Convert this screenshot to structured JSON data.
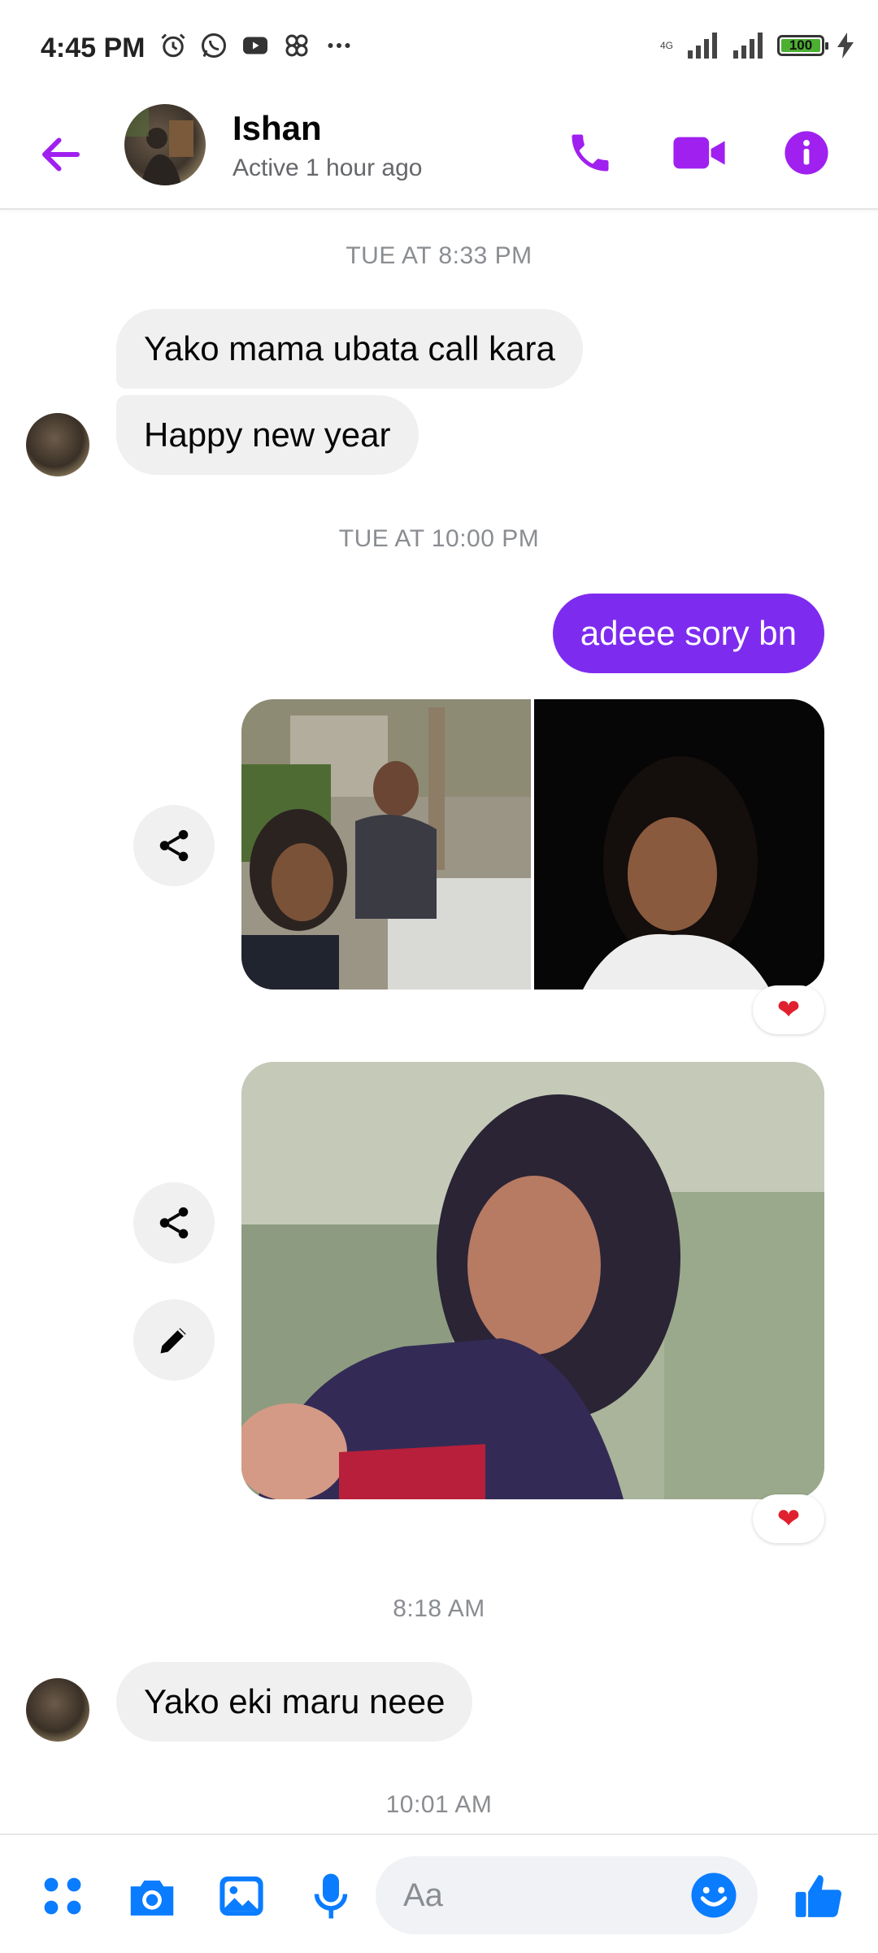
{
  "status_bar": {
    "time": "4:45 PM",
    "network": "4G",
    "battery": "100"
  },
  "header": {
    "contact_name": "Ishan",
    "contact_status": "Active 1 hour ago"
  },
  "messages": {
    "timestamp_1": "TUE AT 8:33 PM",
    "in_1": "Yako mama ubata call kara",
    "in_2": "Happy new year",
    "timestamp_2": "TUE AT 10:00 PM",
    "out_1": "adeee sory bn",
    "timestamp_3": "8:18 AM",
    "in_3": "Yako eki maru neee",
    "timestamp_4": "10:01 AM",
    "reaction_1": "❤",
    "reaction_2": "❤"
  },
  "composer": {
    "placeholder": "Aa"
  },
  "colors": {
    "accent_purple": "#7e2bf0",
    "icon_purple": "#a020f0",
    "composer_blue": "#0a7cff",
    "incoming_bubble": "#f0f0f0"
  },
  "icons": [
    "back-arrow-icon",
    "phone-icon",
    "video-camera-icon",
    "info-icon",
    "share-icon",
    "edit-pencil-icon",
    "menu-dots-icon",
    "camera-icon",
    "gallery-icon",
    "microphone-icon",
    "emoji-icon",
    "thumbs-up-icon"
  ]
}
